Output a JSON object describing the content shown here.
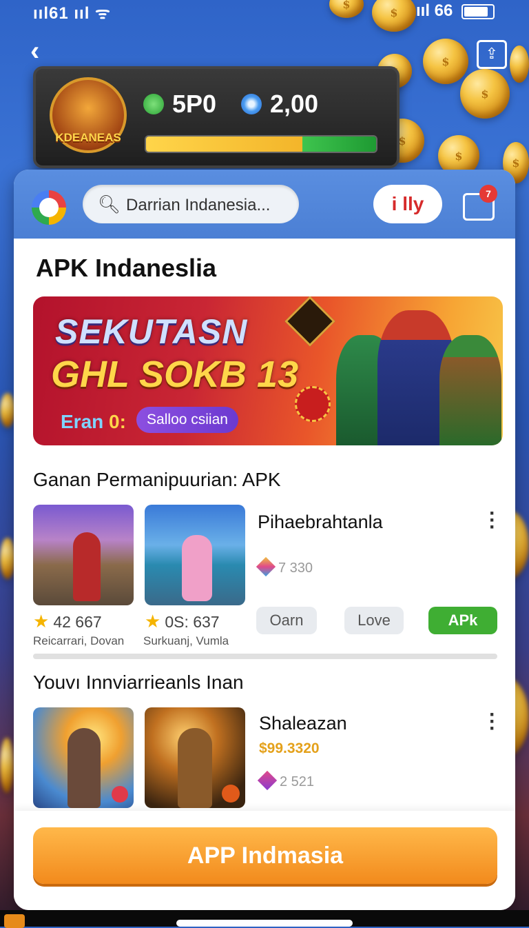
{
  "status_bar": {
    "left": "ııl61 ııl ᯤ",
    "right": "ııl 66"
  },
  "wallet": {
    "logo_text": "KDEANEAS",
    "coins": "5P0",
    "gems": "2,00",
    "progress_yellow": 0.68,
    "progress_green": 0.32
  },
  "search": {
    "placeholder": "Darrian Indanesia..."
  },
  "header": {
    "pill_label": "i lly",
    "cart_badge": "7"
  },
  "page": {
    "title": "APK Indaneslia"
  },
  "banner": {
    "line1": "SEKUTASN",
    "line2": "GHL SOKB 13",
    "earn_label": "Eran",
    "earn_value": "0:",
    "cta": "Salloo csiian"
  },
  "section1": {
    "title": "Ganan Permanipuurian: APK",
    "games": [
      {
        "rating": "42  667",
        "subtitle": "Reicarrari, Dovan"
      },
      {
        "rating": "0S:  637",
        "subtitle": "Surkuanj, Vumla"
      }
    ],
    "app": {
      "name": "Pihaebrahtanla",
      "count": "7 330"
    },
    "chips": [
      "Oarn",
      "Love",
      "APk"
    ]
  },
  "section2": {
    "title": "Youvı Innviarrieanls Inan",
    "app": {
      "name": "Shaleazan",
      "price": "$99.3320",
      "count": "2 521"
    }
  },
  "bottom": {
    "button": "APP Indmasia"
  },
  "colors": {
    "accent_orange": "#f28a1c",
    "header_blue": "#4b7fd4",
    "chip_green": "#3fae33",
    "price_gold": "#e4a11b"
  }
}
